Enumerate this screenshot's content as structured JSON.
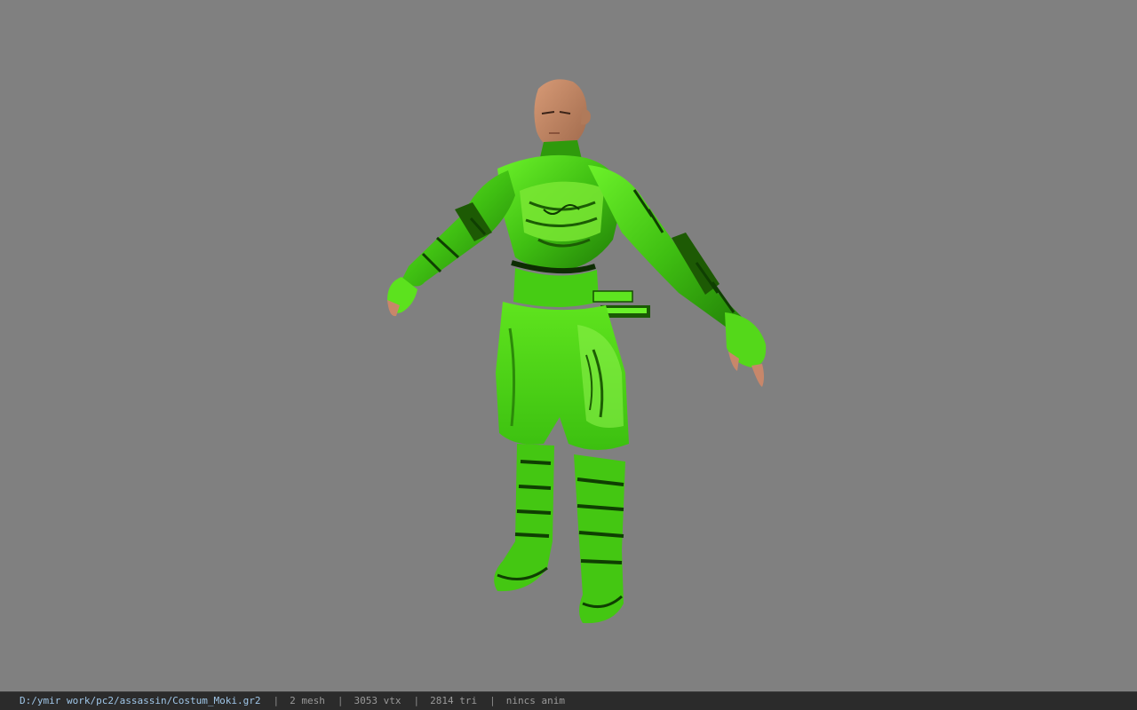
{
  "viewer": {
    "background_color": "#808080",
    "model_name": "Costum_Moki",
    "costume_color": "#4fd81a"
  },
  "statusbar": {
    "file_path": "D:/ymir work/pc2/assassin/Costum_Moki.gr2",
    "separator": "|",
    "mesh_count": "2 mesh",
    "vertex_count": "3053 vtx",
    "triangle_count": "2814 tri",
    "anim_status": "nincs anim"
  }
}
